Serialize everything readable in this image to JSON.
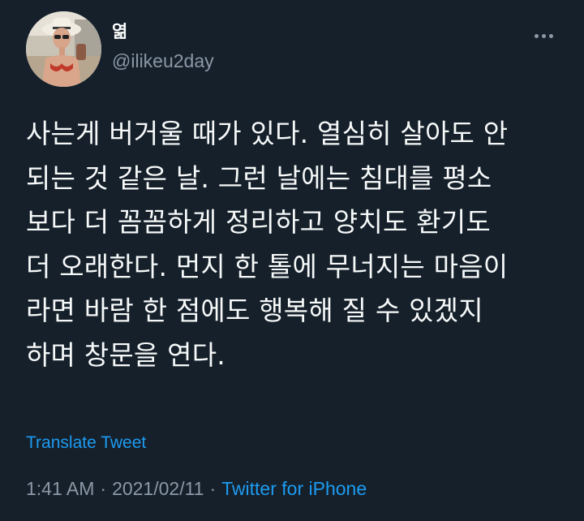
{
  "tweet": {
    "display_name": "엶",
    "handle": "@ilikeu2day",
    "avatar_icon": "user-avatar-photo",
    "more_icon": "more-dots-icon",
    "text_lines": [
      "사는게 버거울 때가 있다. 열심히 살아도 안",
      "되는 것 같은 날. 그런 날에는 침대를 평소",
      "보다 더 꼼꼼하게 정리하고 양치도 환기도",
      "더 오래한다. 먼지 한 톨에 무너지는 마음이",
      "라면 바람 한 점에도 행복해 질 수 있겠지",
      "하며 창문을 연다."
    ],
    "translate_label": "Translate Tweet",
    "time": "1:41 AM",
    "separator": "·",
    "date": "2021/02/11",
    "source": "Twitter for iPhone"
  },
  "colors": {
    "background": "#15202b",
    "text": "#f7f9f9",
    "secondary_text": "#8b98a5",
    "accent": "#1d9bf0"
  }
}
